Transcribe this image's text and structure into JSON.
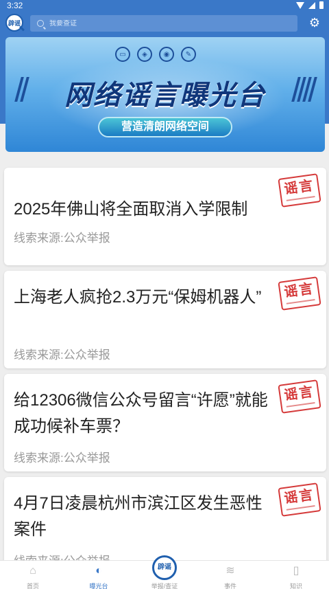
{
  "status_bar": {
    "time": "3:32"
  },
  "top_bar": {
    "logo_text": "辟谣",
    "search_placeholder": "我要查证"
  },
  "banner": {
    "title": "网络谣言曝光台",
    "subtitle": "营造清朗网络空间"
  },
  "cards": [
    {
      "title": "2025年佛山将全面取消入学限制",
      "source": "线索来源:公众举报",
      "stamp": "谣言"
    },
    {
      "title": "上海老人疯抢2.3万元“保姆机器人”",
      "source": "线索来源:公众举报",
      "stamp": "谣言"
    },
    {
      "title": "给12306微信公众号留言“许愿”就能成功候补车票？",
      "source": "线索来源:公众举报",
      "stamp": "谣言"
    },
    {
      "title": "4月7日凌晨杭州市滨江区发生恶性案件",
      "source": "线索来源:公众举报",
      "stamp": "谣言"
    }
  ],
  "bottom_nav": [
    {
      "label": "首页",
      "icon": "home-icon"
    },
    {
      "label": "曝光台",
      "icon": "megaphone-icon"
    },
    {
      "label": "举报/查证",
      "icon": "piyao-logo-icon"
    },
    {
      "label": "事件",
      "icon": "layers-icon"
    },
    {
      "label": "知识",
      "icon": "book-icon"
    }
  ],
  "active_nav_index": 1,
  "colors": {
    "primary": "#3a78c8",
    "stamp_red": "#d53a3a"
  }
}
